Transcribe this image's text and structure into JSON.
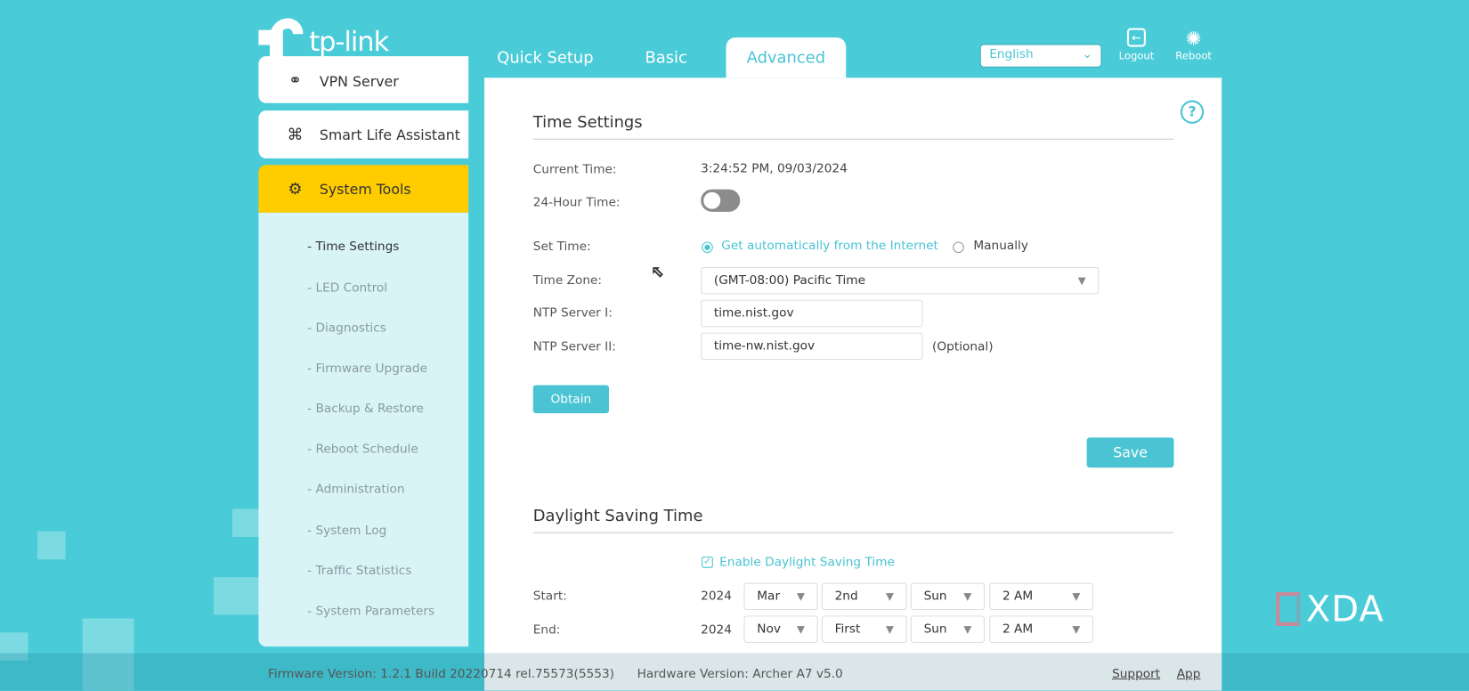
{
  "header": {
    "logo_text": "tp-link",
    "tabs": [
      {
        "label": "Quick Setup"
      },
      {
        "label": "Basic"
      },
      {
        "label": "Advanced",
        "active": true
      }
    ],
    "language": "English",
    "logout_label": "Logout",
    "reboot_label": "Reboot"
  },
  "sidebar": {
    "items": [
      {
        "label": "VPN Server",
        "icon": "vpn-key-icon"
      },
      {
        "label": "Smart Life Assistant",
        "icon": "cloverleaf-icon"
      },
      {
        "label": "System Tools",
        "icon": "gear-icon",
        "active": true
      }
    ],
    "sub_items": [
      {
        "label": "Time Settings",
        "active": true
      },
      {
        "label": "LED Control"
      },
      {
        "label": "Diagnostics"
      },
      {
        "label": "Firmware Upgrade"
      },
      {
        "label": "Backup & Restore"
      },
      {
        "label": "Reboot Schedule"
      },
      {
        "label": "Administration"
      },
      {
        "label": "System Log"
      },
      {
        "label": "Traffic Statistics"
      },
      {
        "label": "System Parameters"
      }
    ],
    "sub_prefix": "-"
  },
  "time_settings": {
    "title": "Time Settings",
    "current_time_label": "Current Time:",
    "current_time": "3:24:52 PM, 09/03/2024",
    "hour24_label": "24-Hour Time:",
    "hour24_on": false,
    "set_time_label": "Set Time:",
    "set_time_options": [
      "Get automatically from the Internet",
      "Manually"
    ],
    "time_zone_label": "Time Zone:",
    "time_zone": "(GMT-08:00) Pacific Time",
    "ntp1_label": "NTP Server I:",
    "ntp1": "time.nist.gov",
    "ntp2_label": "NTP Server II:",
    "ntp2": "time-nw.nist.gov",
    "optional": "(Optional)",
    "obtain": "Obtain",
    "save": "Save"
  },
  "dst": {
    "title": "Daylight Saving Time",
    "enable_label": "Enable Daylight Saving Time",
    "enabled": true,
    "start_label": "Start:",
    "start": {
      "year": "2024",
      "month": "Mar",
      "week": "2nd",
      "day": "Sun",
      "time": "2 AM"
    },
    "end_label": "End:",
    "end": {
      "year": "2024",
      "month": "Nov",
      "week": "First",
      "day": "Sun",
      "time": "2 AM"
    }
  },
  "footer": {
    "firmware": "Firmware Version: 1.2.1 Build 20220714 rel.75573(5553)",
    "hardware": "Hardware Version: Archer A7 v5.0",
    "support": "Support",
    "app": "App"
  },
  "watermark": "XDA",
  "colors": {
    "accent": "#4ac4d3",
    "background": "#4accd8",
    "active_menu": "#ffcc00"
  }
}
